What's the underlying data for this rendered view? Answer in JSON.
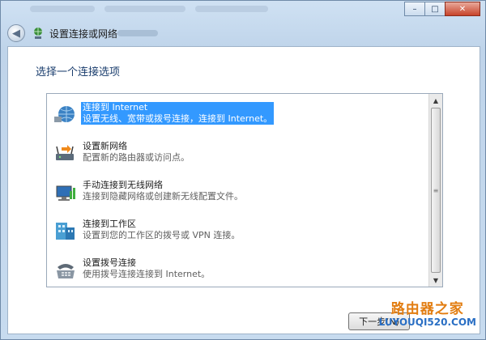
{
  "window": {
    "close_glyph": "✕",
    "minimize_glyph": "–",
    "maximize_glyph": "□"
  },
  "nav": {
    "back_glyph": "◀",
    "title": "设置连接或网络"
  },
  "main": {
    "heading": "选择一个连接选项",
    "options": [
      {
        "title": "连接到 Internet",
        "desc": "设置无线、宽带或拨号连接，连接到 Internet。",
        "icon": "globe-network-icon",
        "selected": true
      },
      {
        "title": "设置新网络",
        "desc": "配置新的路由器或访问点。",
        "icon": "router-icon",
        "selected": false
      },
      {
        "title": "手动连接到无线网络",
        "desc": "连接到隐藏网络或创建新无线配置文件。",
        "icon": "wireless-computer-icon",
        "selected": false
      },
      {
        "title": "连接到工作区",
        "desc": "设置到您的工作区的拨号或 VPN 连接。",
        "icon": "workplace-building-icon",
        "selected": false
      },
      {
        "title": "设置拨号连接",
        "desc": "使用拨号连接连接到 Internet。",
        "icon": "dialup-phone-icon",
        "selected": false
      }
    ]
  },
  "footer": {
    "next_label": "下一步(N)"
  },
  "watermark": {
    "line1": "路由器之家",
    "line2": "LUYOUQI520.COM"
  },
  "colors": {
    "selection": "#3399ff",
    "heading": "#1a3d6d",
    "watermark_orange": "#e27d11",
    "watermark_blue": "#2a6fc4"
  }
}
